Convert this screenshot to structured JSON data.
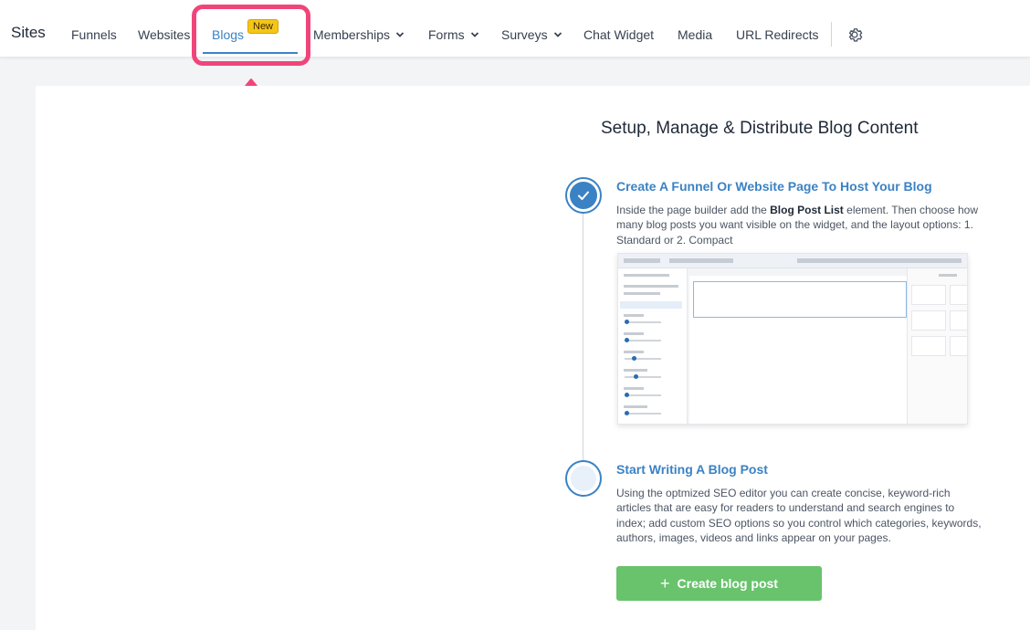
{
  "nav": {
    "brand": "Sites",
    "items": [
      {
        "label": "Funnels"
      },
      {
        "label": "Websites"
      },
      {
        "label": "Blogs",
        "badge": "New",
        "active": true
      },
      {
        "label": "Memberships",
        "dropdown": true
      },
      {
        "label": "Forms",
        "dropdown": true
      },
      {
        "label": "Surveys",
        "dropdown": true
      },
      {
        "label": "Chat Widget"
      },
      {
        "label": "Media"
      },
      {
        "label": "URL Redirects"
      }
    ],
    "settings_icon": "gear-icon"
  },
  "annotation": {
    "highlight_color": "#f0457a",
    "arrow_icon": "arrow-up-icon"
  },
  "main": {
    "title": "Setup, Manage & Distribute Blog Content",
    "steps": [
      {
        "title": "Create A Funnel Or Website Page To Host Your Blog",
        "desc_before": "Inside the page builder add the ",
        "desc_bold": "Blog Post List",
        "desc_after": " element. Then choose how many blog posts you want visible on the widget, and the layout options: 1. Standard or 2. Compact",
        "status": "complete",
        "icon": "check-icon"
      },
      {
        "title": "Start Writing A Blog Post",
        "desc": "Using the optmized SEO editor you can create concise, keyword-rich articles that are easy for readers to understand and search engines to index; add custom SEO options so you control which categories, keywords, authors, images, videos and links appear on your pages.",
        "status": "pending"
      }
    ],
    "button": {
      "label": "Create blog post",
      "icon": "plus-icon"
    }
  },
  "colors": {
    "accent": "#3b82c4",
    "button": "#68c36c",
    "badge": "#f5c518",
    "highlight": "#f0457a"
  }
}
